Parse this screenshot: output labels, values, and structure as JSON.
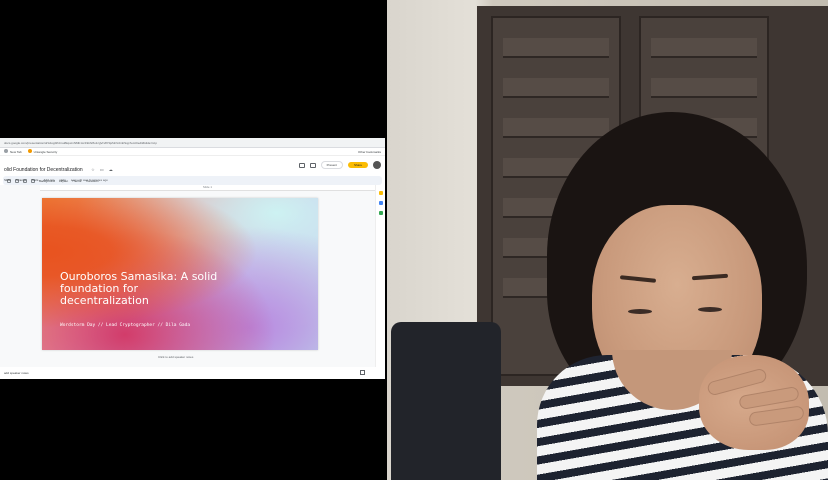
{
  "browser": {
    "url": "docs.google.com/presentation/d/1xkqp9hzrsu8kqwmNMb1cc19khr8u1zgVrs8YfqZdnVdmbSqp7em0/edit#slide=id.p",
    "bookmarks": [
      "New Tab",
      "Untangle Security"
    ],
    "bookmarks_right": "Other bookmarks"
  },
  "doc": {
    "title": "olid Foundation for Decentralization",
    "menu": [
      "Slide",
      "Arrange",
      "Tools",
      "Add-ons",
      "Help"
    ],
    "last_edit": "Last edit was 6 minutes ago",
    "present_label": "Present",
    "share_label": "Share"
  },
  "toolbar": {
    "items": [
      "Background",
      "Layout",
      "Theme",
      "Transition"
    ]
  },
  "ruler_label": "Slide 1",
  "slide": {
    "title": "Ouroboros Samasika: A solid foundation for decentralization",
    "subtitle": "Wordstorm Day // Lead Cryptographer // Dila Gada"
  },
  "notes_label": "Click to add speaker notes",
  "status": {
    "text": "add speaker notes"
  }
}
